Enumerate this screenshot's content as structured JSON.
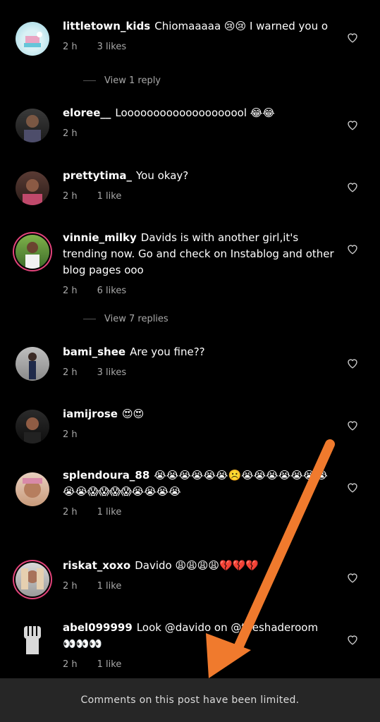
{
  "comments": [
    {
      "user": "littletown_kids",
      "text": "Chiomaaaaa 😢😢 I warned you o",
      "time": "2 h",
      "likes": "3 likes"
    },
    {
      "user": "eloree__",
      "text": "Loooooooooooooooooool 😂😂",
      "time": "2 h",
      "likes": ""
    },
    {
      "user": "prettytima_",
      "text": "You okay?",
      "time": "2 h",
      "likes": "1 like"
    },
    {
      "user": "vinnie_milky",
      "text": "Davids is with another girl,it's trending now. Go and check on Instablog and other blog pages ooo",
      "time": "2 h",
      "likes": "6 likes"
    },
    {
      "user": "bami_shee",
      "text": "Are you fine??",
      "time": "2 h",
      "likes": "3 likes"
    },
    {
      "user": "iamijrose",
      "text": "😍😍",
      "time": "2 h",
      "likes": ""
    },
    {
      "user": "splendoura_88",
      "text": "😭😭😭😭😭😭☹️😭😭😭😭😭😭😭😭😭😱😱😱😱😭😭😭😭",
      "time": "2 h",
      "likes": "1 like"
    },
    {
      "user": "riskat_xoxo",
      "text": "Davido 😩😩😩😩💔💔💔",
      "time": "2 h",
      "likes": "1 like"
    },
    {
      "user": "abel099999",
      "text": "Look @davido on @theshaderoom 👀👀👀",
      "time": "2 h",
      "likes": "1 like"
    }
  ],
  "replies": [
    {
      "label": "View 1 reply"
    },
    {
      "label": "View 7 replies"
    }
  ],
  "footer": {
    "text": "Comments on this post have been limited."
  },
  "colors": {
    "background": "#000000",
    "footer": "#262626",
    "arrow": "#f07a2d",
    "story_ring": "#e2437a"
  },
  "icons": {
    "like": "heart-outline-icon"
  }
}
